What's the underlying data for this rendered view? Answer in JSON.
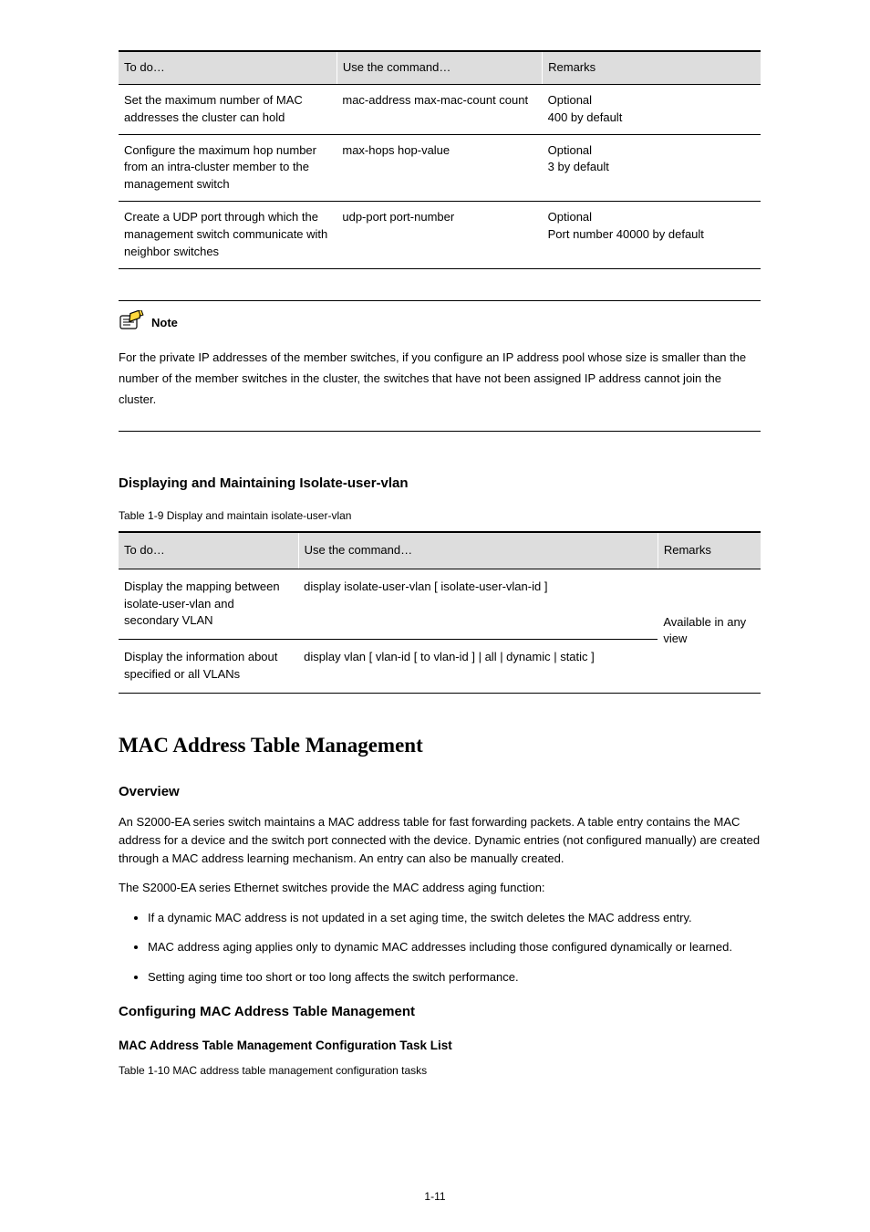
{
  "table1": {
    "headers": {
      "a": "To do…",
      "b": "Use the command…",
      "c": "Remarks"
    },
    "rows": [
      {
        "a": "Set the maximum number of MAC addresses the cluster can hold",
        "b": "mac-address max-mac-count count",
        "c": "Optional\n400 by default"
      },
      {
        "a": "Configure the maximum hop number from an intra-cluster member to the management switch",
        "b": "max-hops hop-value",
        "c": "Optional\n3 by default"
      },
      {
        "a": "Create a UDP port through which the management switch communicate with neighbor switches",
        "b": "udp-port port-number",
        "c": "Optional\nPort number 40000 by default"
      }
    ]
  },
  "note": {
    "label": "Note",
    "body": "For the private IP addresses of the member switches, if you configure an IP address pool whose size is smaller than the number of the member switches in the cluster, the switches that have not been assigned IP address cannot join the cluster."
  },
  "displaying": {
    "heading": "Displaying and Maintaining Isolate-user-vlan",
    "caption": "Table 1-9 Display and maintain isolate-user-vlan",
    "headers": {
      "a": "To do…",
      "b": "Use the command…",
      "c": "Remarks"
    },
    "rows": [
      {
        "a": "Display the mapping between isolate-user-vlan and secondary VLAN",
        "b": "display isolate-user-vlan [ isolate-user-vlan-id ]",
        "c": "Available in any view"
      },
      {
        "a": "Display the information about specified or all VLANs",
        "b": "display vlan [ vlan-id [ to vlan-id ] | all | dynamic | static ]",
        "c": ""
      }
    ],
    "remarks_shared": "Available in any view"
  },
  "mac": {
    "heading": "MAC Address Table Management",
    "overview_heading": "Overview",
    "overview_text": "An S2000-EA series switch maintains a MAC address table for fast forwarding packets. A table entry contains the MAC address for a device and the switch port connected with the device. Dynamic entries (not configured manually) are created through a MAC address learning mechanism. An entry can also be manually created.",
    "aging_intro": "The S2000-EA series Ethernet switches provide the MAC address aging function:",
    "aging_items": [
      "If a dynamic MAC address is not updated in a set aging time, the switch deletes the MAC address entry.",
      "MAC address aging applies only to dynamic MAC addresses including those configured dynamically or learned.",
      "Setting aging time too short or too long affects the switch performance."
    ],
    "config_heading": "Configuring MAC Address Table Management",
    "task_heading": "MAC Address Table Management Configuration Task List",
    "task_caption": "Table 1-10 MAC address table management configuration tasks"
  },
  "page_number": "1-11"
}
